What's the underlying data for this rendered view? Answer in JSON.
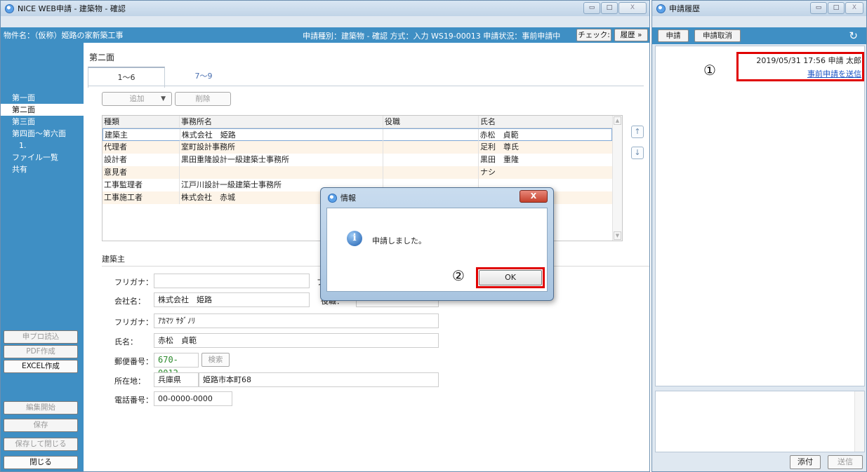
{
  "main_window": {
    "title": "NICE WEB申請 - 建築物 - 確認",
    "controls": {
      "minimize": "▭",
      "maximize": "□",
      "close": "X"
    }
  },
  "infobar": {
    "property": "物件名：（仮称）姫路の家新築工事",
    "status": "申請種別：建築物 - 確認 方式：入力 WS19-00013 申請状況：事前申請中",
    "check_button": "チェック:",
    "history_button": "履歴 »"
  },
  "sidebar": {
    "items": [
      "第一面",
      "第二面",
      "第三面",
      "第四面～第六面",
      "1.",
      "ファイル一覧",
      "共有"
    ],
    "active_index": 1,
    "buttons_top": [
      "申プロ読込",
      "PDF作成",
      "EXCEL作成"
    ],
    "buttons_bottom": [
      "編集開始",
      "保存",
      "保存して閉じる",
      "閉じる"
    ]
  },
  "content": {
    "section_title": "第二面",
    "tabs": [
      "1～6",
      "7～9"
    ],
    "add_button": "追加",
    "delete_button": "削除",
    "grid": {
      "headers": [
        "種類",
        "事務所名",
        "役職",
        "氏名"
      ],
      "rows": [
        [
          "建築主",
          "株式会社　姫路",
          "",
          "赤松　貞範"
        ],
        [
          "代理者",
          "室町設計事務所",
          "",
          "足利　尊氏"
        ],
        [
          "設計者",
          "黒田重隆設計一級建築士事務所",
          "",
          "黒田　重隆"
        ],
        [
          "意見者",
          "",
          "",
          "ナシ"
        ],
        [
          "工事監理者",
          "江戸川設計一級建築士事務所",
          "",
          ""
        ],
        [
          "工事施工者",
          "株式会社　赤城",
          "",
          ""
        ]
      ]
    },
    "move_up": "↑",
    "move_down": "↓",
    "form": {
      "heading": "建築主",
      "furigana1_label": "フリガナ：",
      "furigana1_value": "",
      "furigana2_partial": "フ",
      "company_label": "会社名：",
      "company_value": "株式会社　姫路",
      "position_partial": "役職：",
      "furigana3_label": "フリガナ：",
      "furigana3_value": "ｱｶﾏﾂ ｻﾀﾞﾉﾘ",
      "name_label": "氏名：",
      "name_value": "赤松　貞範",
      "zip_label": "郵便番号：",
      "zip_value": "670-0012",
      "search_button": "検索",
      "address_label": "所在地：",
      "prefecture_value": "兵庫県",
      "address_value": "姫路市本町68",
      "phone_label": "電話番号：",
      "phone_value": "00-0000-0000"
    }
  },
  "dialog": {
    "title": "情報",
    "close": "X",
    "message": "申請しました。",
    "ok_button": "OK",
    "marker": "②"
  },
  "history_window": {
    "title": "申請履歴",
    "controls": {
      "minimize": "▭",
      "maximize": "□",
      "close": "X"
    },
    "apply_button": "申請",
    "cancel_button": "申請取消",
    "refresh_icon": "↻",
    "entry_line": "2019/05/31 17:56  申請  太郎",
    "entry_link": "事前申請を送信",
    "marker": "①",
    "attach_button": "添付",
    "send_button": "送信"
  },
  "colors": {
    "accent": "#3f8fc4",
    "highlight": "#e00000",
    "link": "#1c55c4",
    "zip": "#2d8a2d"
  }
}
